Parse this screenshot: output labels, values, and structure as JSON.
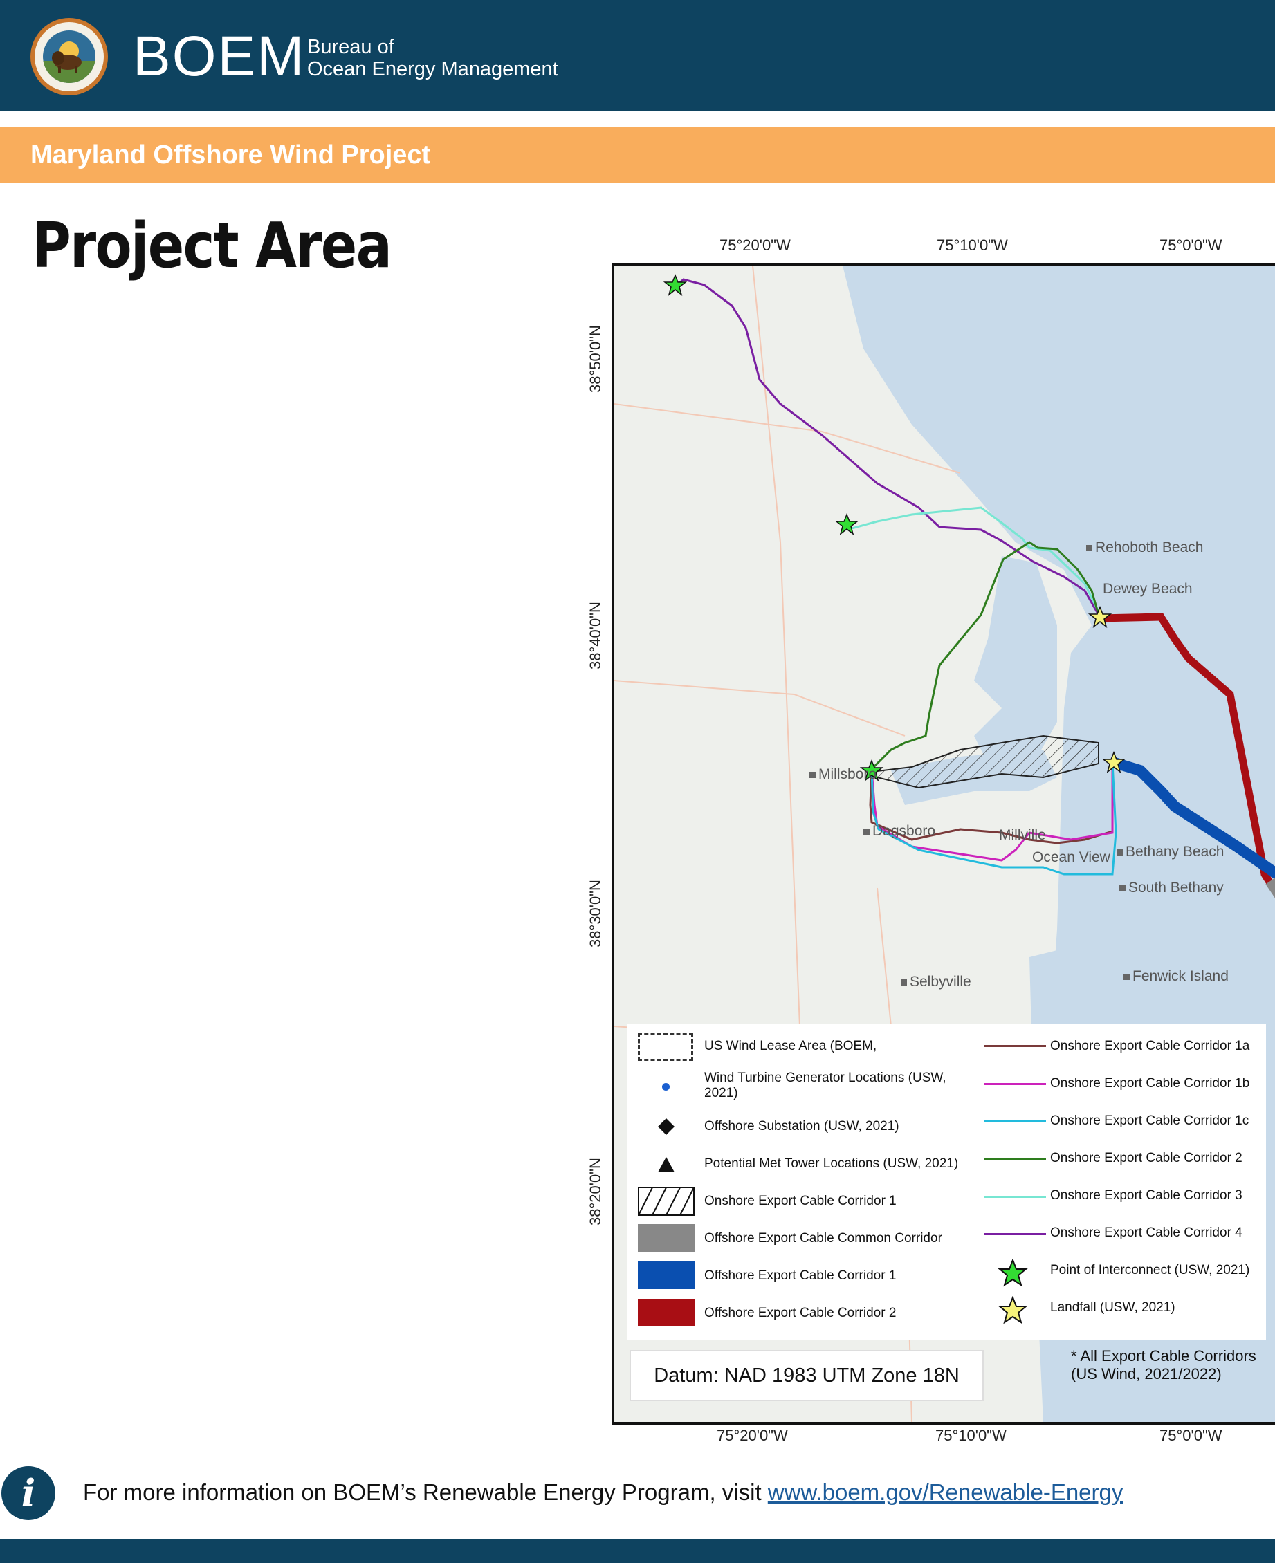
{
  "header": {
    "brand": "BOEM",
    "agency_line1": "Bureau of",
    "agency_line2": "Ocean Energy Management",
    "seal_icon": "doi-bison-seal-icon"
  },
  "banner": {
    "title": "Maryland Offshore Wind Project"
  },
  "page_title": "Project Area",
  "map": {
    "lon_labels_top": [
      "75°20'0\"W",
      "75°10'0\"W",
      "75°0'0\"W"
    ],
    "lon_labels_bottom": [
      "75°20'0\"W",
      "75°10'0\"W",
      "75°0'0\"W"
    ],
    "lat_labels": [
      "38°50'0\"N",
      "38°40'0\"N",
      "38°30'0\"N",
      "38°20'0\"N"
    ],
    "towns": [
      "Rehoboth Beach",
      "Dewey Beach",
      "Millsboro",
      "Dagsboro",
      "Millville",
      "Ocean View",
      "Bethany Beach",
      "South Bethany",
      "Selbyville",
      "Fenwick Island"
    ],
    "colors": {
      "corridor_1a": "#7a3a3a",
      "corridor_1b": "#cc22bb",
      "corridor_1c": "#22bbdd",
      "corridor_2": "#2e7d1e",
      "corridor_3": "#77e6d2",
      "corridor_4": "#7a1fa2",
      "offshore_1": "#0a4fb0",
      "offshore_2": "#a80e14",
      "offshore_common": "#888888",
      "poi_star": "#33dd33",
      "landfall_star": "#f6f27a",
      "water": "#c8daea",
      "land": "#eef0ec"
    }
  },
  "legend": {
    "left": [
      {
        "label": "US Wind Lease Area (BOEM,",
        "symbol": "dashed-box-icon"
      },
      {
        "label": "Wind Turbine Generator Locations (USW, 2021)",
        "symbol": "blue-dot-icon"
      },
      {
        "label": "Offshore Substation (USW, 2021)",
        "symbol": "diamond-icon"
      },
      {
        "label": "Potential Met Tower Locations (USW, 2021)",
        "symbol": "triangle-icon"
      },
      {
        "label": "Onshore Export Cable Corridor 1",
        "symbol": "hatched-box-icon"
      },
      {
        "label": "Offshore Export Cable Common Corridor",
        "symbol": "gray-box-icon"
      },
      {
        "label": "Offshore Export Cable Corridor 1",
        "symbol": "blue-box-icon"
      },
      {
        "label": "Offshore Export Cable Corridor 2",
        "symbol": "red-box-icon"
      }
    ],
    "right": [
      {
        "label": "Onshore Export Cable Corridor 1a",
        "symbol": "brown-line-icon"
      },
      {
        "label": "Onshore Export Cable Corridor 1b",
        "symbol": "magenta-line-icon"
      },
      {
        "label": "Onshore Export Cable Corridor 1c",
        "symbol": "cyan-line-icon"
      },
      {
        "label": "Onshore Export Cable Corridor 2",
        "symbol": "green-line-icon"
      },
      {
        "label": "Onshore Export Cable Corridor 3",
        "symbol": "aqua-line-icon"
      },
      {
        "label": "Onshore Export Cable Corridor 4",
        "symbol": "purple-line-icon"
      },
      {
        "label": "Point of Interconnect (USW, 2021)",
        "symbol": "green-star-icon"
      },
      {
        "label": "Landfall (USW, 2021)",
        "symbol": "yellow-star-icon"
      }
    ]
  },
  "datum": "Datum: NAD 1983 UTM Zone 18N",
  "note_line1": "* All Export Cable Corridors",
  "note_line2": "(US Wind, 2021/2022)",
  "footer": {
    "info_icon": "info-icon",
    "text": "For more information on BOEM’s Renewable Energy Program, visit ",
    "link": "www.boem.gov/Renewable-Energy"
  }
}
